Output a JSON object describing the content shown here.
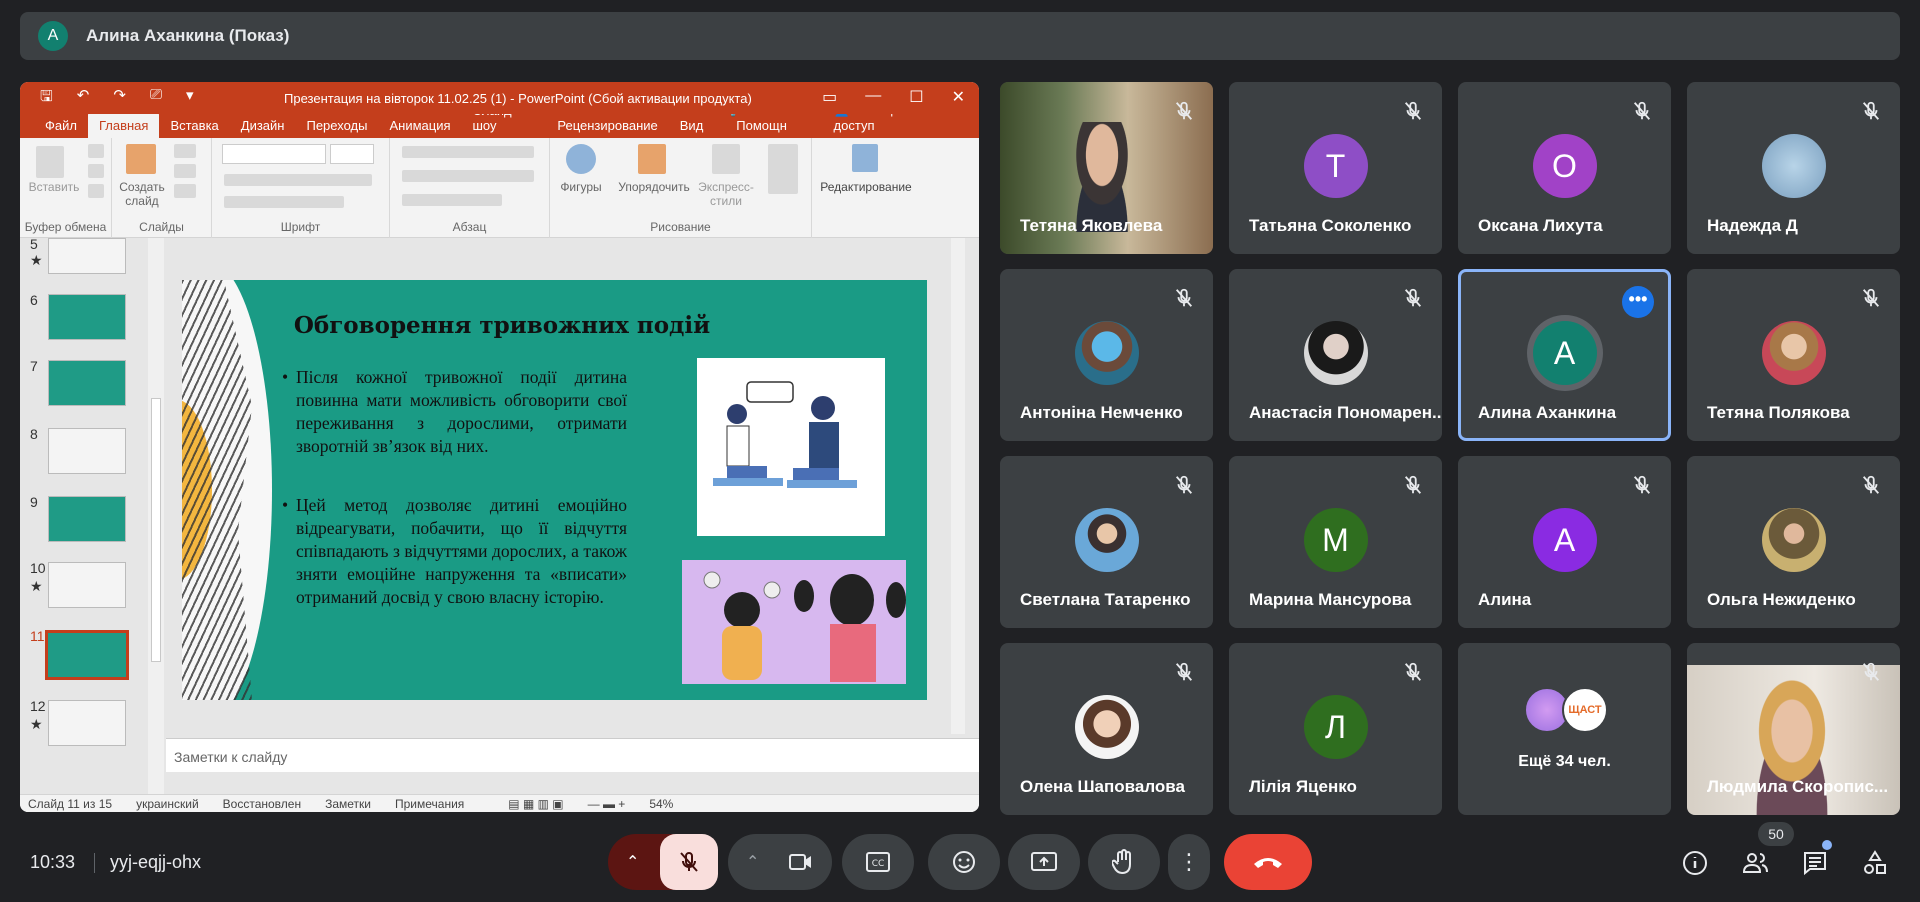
{
  "presenter_banner": {
    "avatar_letter": "А",
    "text": "Алина Аханкина (Показ)"
  },
  "powerpoint": {
    "title": "Презентация на вівторок 11.02.25 (1) - PowerPoint (Сбой активации продукта)",
    "menu": [
      "Файл",
      "Главная",
      "Вставка",
      "Дизайн",
      "Переходы",
      "Анимация",
      "Слайд-шоу",
      "Рецензирование",
      "Вид"
    ],
    "help": "Помощн",
    "share": "Общий доступ",
    "ribbon": {
      "paste": "Вставить",
      "create_slide": "Создать слайд",
      "figures": "Фигуры",
      "arrange": "Упорядочить",
      "express_styles": "Экспресс-стили",
      "editing": "Редактирование",
      "groups": [
        "Буфер обмена",
        "Слайды",
        "Шрифт",
        "Абзац",
        "Рисование"
      ]
    },
    "thumbnails": [
      {
        "num": "5",
        "star": "★"
      },
      {
        "num": "6"
      },
      {
        "num": "7"
      },
      {
        "num": "8"
      },
      {
        "num": "9"
      },
      {
        "num": "10",
        "star": "★"
      },
      {
        "num": "11",
        "selected": true
      },
      {
        "num": "12",
        "star": "★"
      }
    ],
    "slide": {
      "title": "Обговорення тривожних подій",
      "bullet1": "Після кожної тривожної події дитина повинна мати можливість обговорити свої переживання з дорослими, отримати зворотній зв’язок від них.",
      "bullet2": "Цей метод дозволяє дитині емоційно відреагувати, побачити, що її відчуття співпадають з відчуттями дорослих, а також зняти емоційне напруження та «вписати» отриманий досвід у свою власну історію."
    },
    "notes_placeholder": "Заметки к слайду",
    "status": {
      "slide_count": "Слайд 11 из 15",
      "language": "украинский",
      "recovered": "Восстановлен",
      "notes": "Заметки",
      "comments": "Примечания",
      "zoom": "54%"
    }
  },
  "participants": [
    {
      "name": "Тетяна Яковлева",
      "type": "video"
    },
    {
      "name": "Татьяна Соколенко",
      "letter": "T",
      "color": "#8e4ec6"
    },
    {
      "name": "Оксана Лихута",
      "letter": "O",
      "color": "#a142c7"
    },
    {
      "name": "Надежда Д",
      "type": "photo"
    },
    {
      "name": "Антоніна Немченко",
      "type": "photo"
    },
    {
      "name": "Анастасія Пономарен...",
      "type": "photo"
    },
    {
      "name": "Алина Аханкина",
      "letter": "A",
      "color": "#12806f",
      "active": true
    },
    {
      "name": "Тетяна Полякова",
      "type": "photo"
    },
    {
      "name": "Светлана Татаренко",
      "type": "photo"
    },
    {
      "name": "Марина Мансурова",
      "letter": "M",
      "color": "#2f6e1f"
    },
    {
      "name": "Алина",
      "letter": "A",
      "color": "#8a2be2"
    },
    {
      "name": "Ольга Нежиденко",
      "type": "photo"
    },
    {
      "name": "Олена Шаповалова",
      "type": "photo"
    },
    {
      "name": "Лілія Яценко",
      "letter": "Л",
      "color": "#2f6e1f"
    },
    {
      "name": "Ещё 34 чел.",
      "type": "more"
    },
    {
      "name": "Людмила Скоропис...",
      "type": "video"
    }
  ],
  "more_badge": "ЩАСТ",
  "bottom_bar": {
    "time": "10:33",
    "meeting_code": "yyj-eqjj-ohx",
    "participant_count": "50"
  },
  "colors": {
    "background": "#202124",
    "tile": "#3c4043",
    "hangup": "#ea4335",
    "accent": "#8ab4f8"
  }
}
